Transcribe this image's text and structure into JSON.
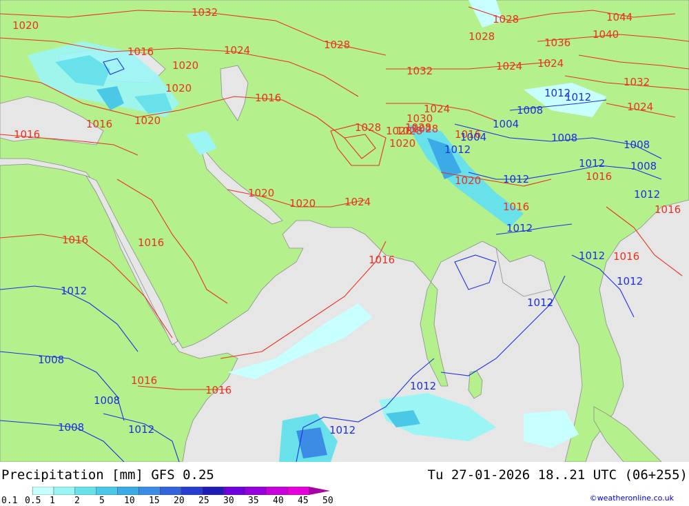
{
  "title": "Precipitation [mm]  GFS 0.25",
  "valid_time": "Tu 27-01-2026 18..21 UTC (06+255)",
  "credit": "©weatheronline.co.uk",
  "colors": {
    "land": "#b4f08c",
    "sea": "#e6e6e6",
    "border": "#8c8c8c",
    "isobar_high": "#e8321e",
    "isobar_low": "#1e2ee0"
  },
  "legend": {
    "labels": [
      "0.1",
      "0.5",
      "1",
      "2",
      "5",
      "10",
      "15",
      "20",
      "25",
      "30",
      "35",
      "40",
      "45",
      "50"
    ],
    "colors": [
      "#c8ffff",
      "#9bf5f5",
      "#69e1eb",
      "#4bc8e6",
      "#3caae6",
      "#3c8ce6",
      "#3264dc",
      "#283cd2",
      "#1e1eb4",
      "#6e00dc",
      "#9600dc",
      "#c800dc",
      "#e600dc",
      "#aa00aa"
    ]
  },
  "isobar_labels_red": [
    {
      "text": "1032"
    },
    {
      "text": "1020"
    },
    {
      "text": "1016"
    },
    {
      "text": "1024"
    },
    {
      "text": "1028"
    },
    {
      "text": "1020"
    },
    {
      "text": "1020"
    },
    {
      "text": "1016"
    },
    {
      "text": "1016"
    },
    {
      "text": "1020"
    },
    {
      "text": "1016"
    },
    {
      "text": "1028"
    },
    {
      "text": "1028"
    },
    {
      "text": "1028"
    },
    {
      "text": "1032"
    },
    {
      "text": "1024"
    },
    {
      "text": "1030"
    },
    {
      "text": "1028"
    },
    {
      "text": "1028"
    },
    {
      "text": "1020"
    },
    {
      "text": "1020"
    },
    {
      "text": "1020"
    },
    {
      "text": "1024"
    },
    {
      "text": "1016"
    },
    {
      "text": "1016"
    },
    {
      "text": "1016"
    },
    {
      "text": "1016"
    },
    {
      "text": "1016"
    },
    {
      "text": "1044"
    },
    {
      "text": "1040"
    },
    {
      "text": "1028"
    },
    {
      "text": "1028"
    },
    {
      "text": "1036"
    },
    {
      "text": "1024"
    },
    {
      "text": "1024"
    },
    {
      "text": "1032"
    },
    {
      "text": "1024"
    },
    {
      "text": "1020"
    },
    {
      "text": "1016"
    },
    {
      "text": "1016"
    },
    {
      "text": "1016"
    },
    {
      "text": "1016"
    },
    {
      "text": "1016"
    }
  ],
  "isobar_labels_blue": [
    {
      "text": "1012"
    },
    {
      "text": "1008"
    },
    {
      "text": "1008"
    },
    {
      "text": "1008"
    },
    {
      "text": "1012"
    },
    {
      "text": "1012"
    },
    {
      "text": "1012"
    },
    {
      "text": "1012"
    },
    {
      "text": "1012"
    },
    {
      "text": "1012"
    },
    {
      "text": "1012"
    },
    {
      "text": "1012"
    },
    {
      "text": "1008"
    },
    {
      "text": "1004"
    },
    {
      "text": "1004"
    },
    {
      "text": "1008"
    },
    {
      "text": "1008"
    },
    {
      "text": "1008"
    },
    {
      "text": "1012"
    },
    {
      "text": "1012"
    },
    {
      "text": "1012"
    },
    {
      "text": "1012"
    },
    {
      "text": "1012"
    }
  ]
}
